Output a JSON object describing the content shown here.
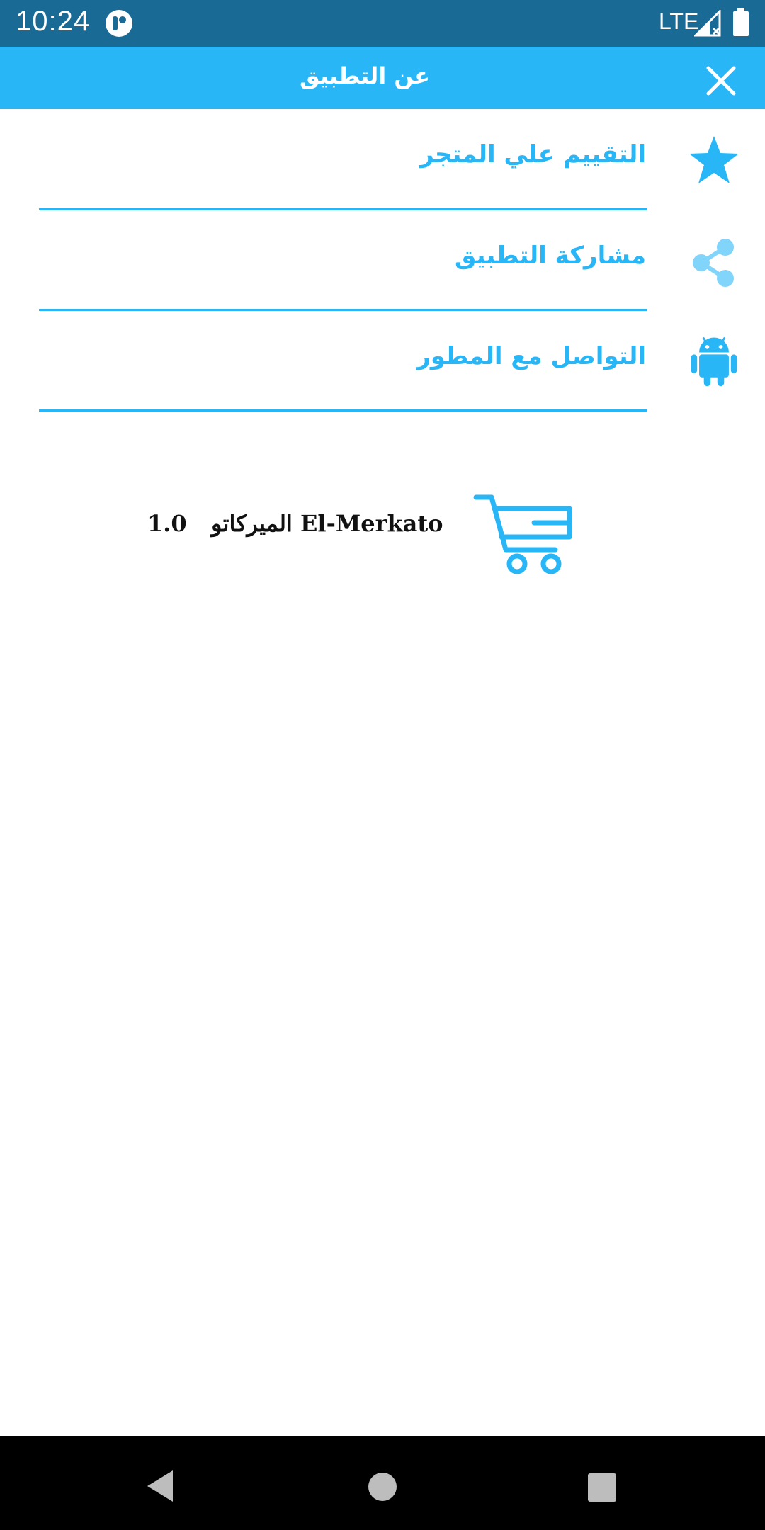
{
  "status_bar": {
    "time": "10:24",
    "network": "LTE",
    "background_color": "#1a6a96"
  },
  "app_bar": {
    "title": "عن التطبيق",
    "close_icon": "close-icon",
    "background_color": "#29b6f6"
  },
  "menu": {
    "accent_color": "#29b6f6",
    "items": [
      {
        "label": "التقييم علي المتجر",
        "icon": "star-icon"
      },
      {
        "label": "مشاركة التطبيق",
        "icon": "share-icon"
      },
      {
        "label": "التواصل مع المطور",
        "icon": "android-icon"
      }
    ]
  },
  "app_info": {
    "name": "الميركاتو El-Merkato",
    "version": "1.0",
    "icon": "shopping-cart-icon"
  },
  "nav_bar": {
    "back_icon": "back-icon",
    "home_icon": "home-icon",
    "recents_icon": "recents-icon"
  }
}
